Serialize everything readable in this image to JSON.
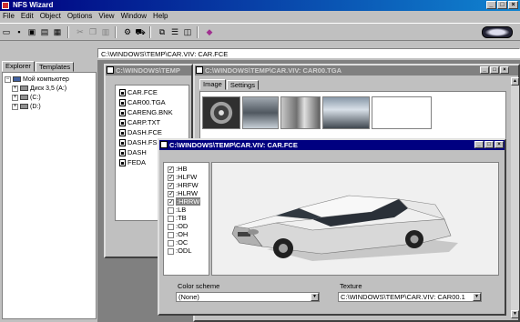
{
  "app": {
    "title": "NFS Wizard"
  },
  "menu": [
    "File",
    "Edit",
    "Object",
    "Options",
    "View",
    "Window",
    "Help"
  ],
  "toolbar_icons": [
    "new-icon",
    "save-icon",
    "save-all-icon",
    "open-icon",
    "properties-icon",
    "cut-icon",
    "copy-icon",
    "paste-icon",
    "car-icon",
    "export-icon",
    "tile-icon",
    "cascade-icon",
    "window-icon",
    "eraser-icon"
  ],
  "path_bar": "C:\\WINDOWS\\TEMP\\CAR.VIV: CAR.FCE",
  "left_panel": {
    "tabs": [
      "Explorer",
      "Templates"
    ],
    "tree": [
      "Мой компьютер",
      "Диск 3,5 (A:)",
      "(C:)",
      "(D:)"
    ]
  },
  "viv_window": {
    "title": "C:\\WINDOWS\\TEMP",
    "files": [
      "CAR.FCE",
      "CAR00.TGA",
      "CARENG.BNK",
      "CARP.TXT",
      "DASH.FCE",
      "DASH.FSH",
      "DASH",
      "FEDA"
    ]
  },
  "tga_window": {
    "title": "C:\\WINDOWS\\TEMP\\CAR.VIV: CAR00.TGA",
    "tabs": [
      "Image",
      "Settings"
    ]
  },
  "fce_window": {
    "title": "C:\\WINDOWS\\TEMP\\CAR.VIV: CAR.FCE",
    "parts": [
      {
        "label": ":HB",
        "checked": true
      },
      {
        "label": ":HLFW",
        "checked": true
      },
      {
        "label": ":HRFW",
        "checked": true
      },
      {
        "label": ":HLRW",
        "checked": true
      },
      {
        "label": ":HRRW",
        "checked": true
      },
      {
        "label": ":LB",
        "checked": false
      },
      {
        "label": ":TB",
        "checked": false
      },
      {
        "label": ":OD",
        "checked": false
      },
      {
        "label": ":OH",
        "checked": false
      },
      {
        "label": ":OC",
        "checked": false
      },
      {
        "label": ":ODL",
        "checked": false
      }
    ],
    "color_scheme_label": "Color scheme",
    "color_scheme_value": "(None)",
    "texture_label": "Texture",
    "texture_value": "C:\\WINDOWS\\TEMP\\CAR.VIV: CAR00.1"
  },
  "colors": {
    "title_active": "#000080",
    "title_inactive": "#808080",
    "face": "#c0c0c0",
    "mdi_bg": "#808080",
    "viewport_bg": "#f0f0f0"
  }
}
